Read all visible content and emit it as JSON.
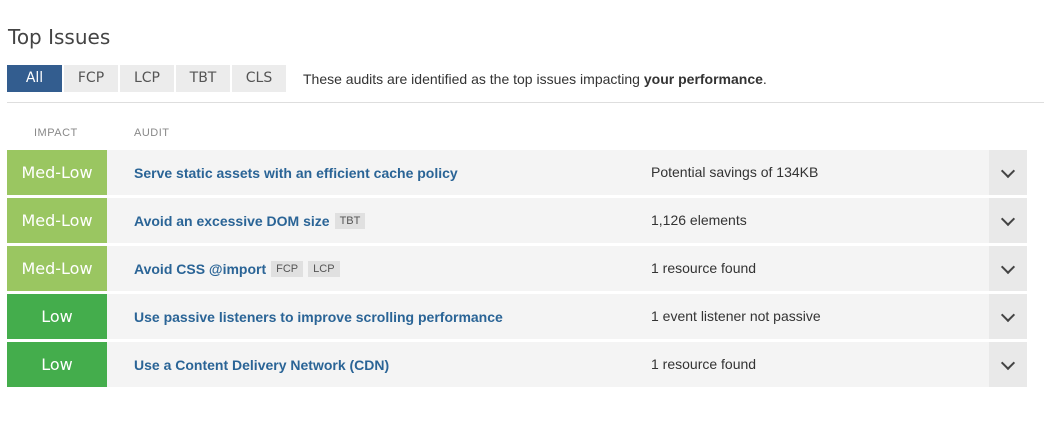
{
  "title": "Top Issues",
  "tabs": [
    {
      "label": "All",
      "active": true
    },
    {
      "label": "FCP",
      "active": false
    },
    {
      "label": "LCP",
      "active": false
    },
    {
      "label": "TBT",
      "active": false
    },
    {
      "label": "CLS",
      "active": false
    }
  ],
  "tab_description": {
    "prefix": "These audits are identified as the top issues impacting ",
    "bold": "your performance",
    "suffix": "."
  },
  "columns": {
    "impact": "IMPACT",
    "audit": "AUDIT"
  },
  "colors": {
    "tab_active": "#335d8f",
    "impact_med_low": "#9ac661",
    "impact_low": "#44ad4c",
    "audit_link": "#2a6496"
  },
  "rows": [
    {
      "impact": "Med-Low",
      "audit": "Serve static assets with an efficient cache policy",
      "badges": [],
      "detail": "Potential savings of 134KB"
    },
    {
      "impact": "Med-Low",
      "audit": "Avoid an excessive DOM size",
      "badges": [
        "TBT"
      ],
      "detail": "1,126 elements"
    },
    {
      "impact": "Med-Low",
      "audit": "Avoid CSS @import",
      "badges": [
        "FCP",
        "LCP"
      ],
      "detail": "1 resource found"
    },
    {
      "impact": "Low",
      "audit": "Use passive listeners to improve scrolling performance",
      "badges": [],
      "detail": "1 event listener not passive"
    },
    {
      "impact": "Low",
      "audit": "Use a Content Delivery Network (CDN)",
      "badges": [],
      "detail": "1 resource found"
    }
  ],
  "icons": {
    "expand": "chevron-down-icon"
  }
}
